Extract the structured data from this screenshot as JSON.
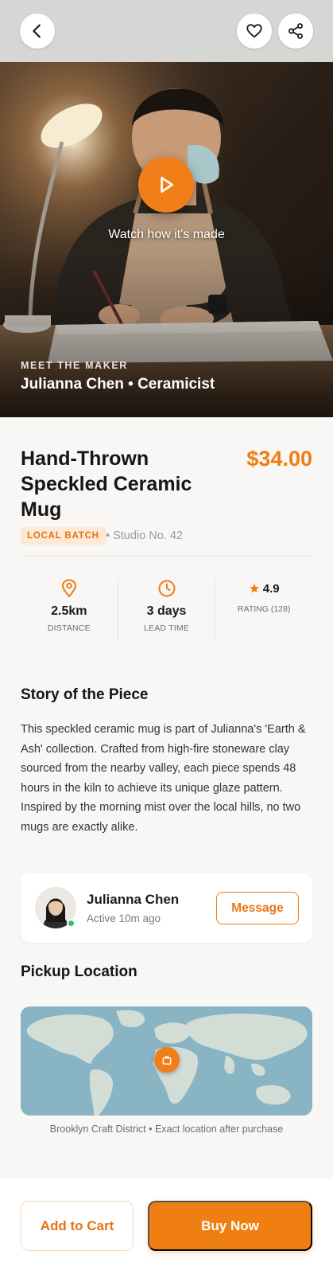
{
  "hero": {
    "video_label": "Watch how it's made",
    "maker_kicker": "MEET THE MAKER",
    "maker_line": "Julianna Chen • Ceramicist"
  },
  "icons": {
    "back": "chevron-left-icon",
    "favorite": "heart-icon",
    "share": "share-icon",
    "play": "play-icon",
    "distance": "location-pin-icon",
    "lead_time": "clock-icon",
    "rating": "star-icon",
    "map_pin": "shopping-bag-icon"
  },
  "product": {
    "title": "Hand-Thrown Speckled Ceramic Mug",
    "price": "$34.00",
    "badge": "LOCAL BATCH",
    "studio": "• Studio No. 42"
  },
  "stats": {
    "distance": {
      "value": "2.5km",
      "label": "DISTANCE"
    },
    "lead_time": {
      "value": "3 days",
      "label": "LEAD TIME"
    },
    "rating": {
      "value": "4.9",
      "label": "RATING (128)"
    }
  },
  "story": {
    "title": "Story of the Piece",
    "body": "This speckled ceramic mug is part of Julianna's 'Earth & Ash' collection. Crafted from high-fire stoneware clay sourced from the nearby valley, each piece spends 48 hours in the kiln to achieve its unique glaze pattern. Inspired by the morning mist over the local hills, no two mugs are exactly alike."
  },
  "maker_card": {
    "name": "Julianna Chen",
    "status": "Active 10m ago",
    "message_label": "Message"
  },
  "pickup": {
    "title": "Pickup Location",
    "caption": "Brooklyn Craft District • Exact location after purchase"
  },
  "actions": {
    "add_to_cart": "Add to Cart",
    "buy_now": "Buy Now"
  },
  "colors": {
    "accent": "#f07f13",
    "badge_bg": "#fde9d6",
    "online": "#2ec55f",
    "map_water": "#86b3c3",
    "map_land": "#d4ded8"
  }
}
